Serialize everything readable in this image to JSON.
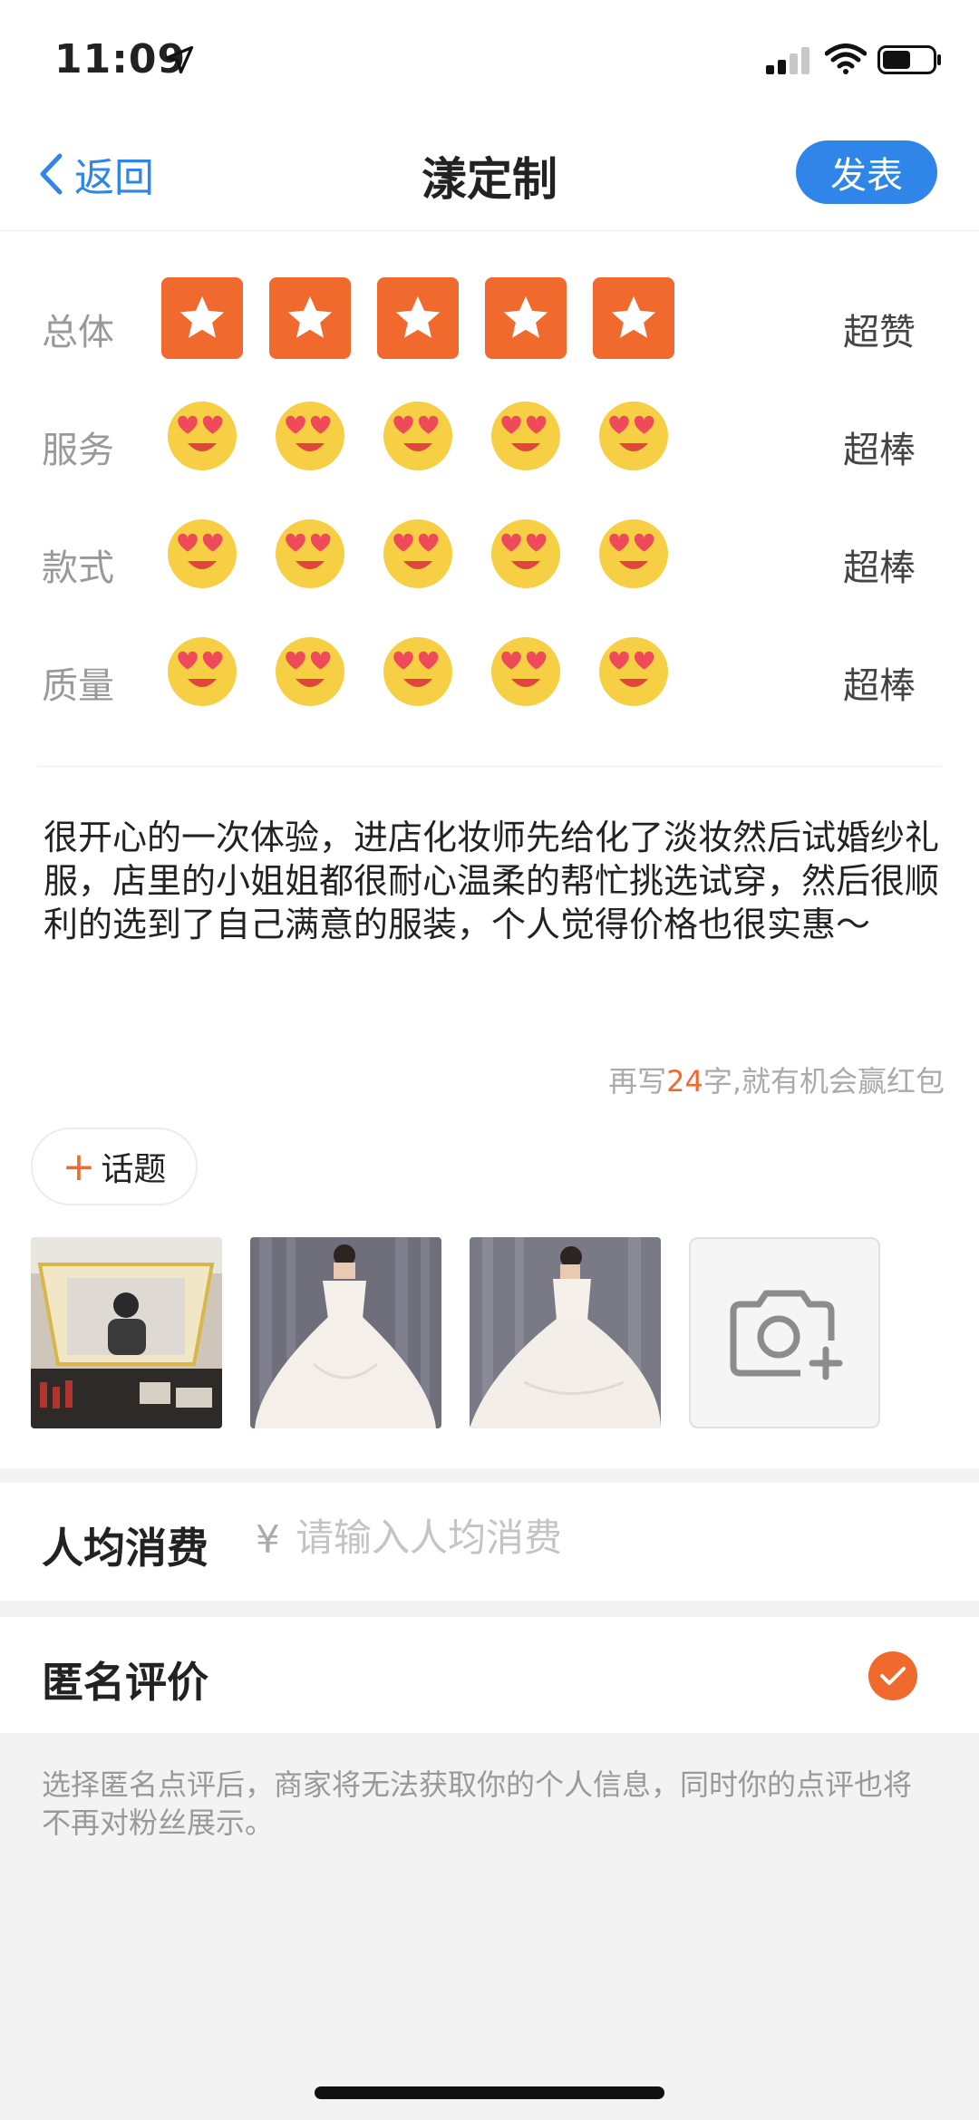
{
  "status": {
    "time": "11:09"
  },
  "nav": {
    "back_label": "返回",
    "title": "漾定制",
    "publish_label": "发表"
  },
  "ratings": [
    {
      "label": "总体",
      "icon": "star-icon",
      "score": 5,
      "max": 5,
      "value": "超赞"
    },
    {
      "label": "服务",
      "icon": "heart-eyes-emoji-icon",
      "score": 5,
      "max": 5,
      "value": "超棒"
    },
    {
      "label": "款式",
      "icon": "heart-eyes-emoji-icon",
      "score": 5,
      "max": 5,
      "value": "超棒"
    },
    {
      "label": "质量",
      "icon": "heart-eyes-emoji-icon",
      "score": 5,
      "max": 5,
      "value": "超棒"
    }
  ],
  "review": {
    "text": "很开心的一次体验，进店化妆师先给化了淡妆然后试婚纱礼服，店里的小姐姐都很耐心温柔的帮忙挑选试穿，然后很顺利的选到了自己满意的服装，个人觉得价格也很实惠～"
  },
  "hint": {
    "prefix": "再写",
    "count": "24",
    "suffix": "字,就有机会赢红包"
  },
  "topic": {
    "plus": "+",
    "label": "话题"
  },
  "photos": [
    "photo-makeup-mirror",
    "photo-wedding-dress-front",
    "photo-wedding-dress-back"
  ],
  "spend": {
    "label": "人均消费",
    "currency": "¥",
    "placeholder": "请输入人均消费",
    "value": ""
  },
  "anonymous": {
    "label": "匿名评价",
    "checked": true,
    "note": "选择匿名点评后，商家将无法获取你的个人信息，同时你的点评也将不再对粉丝展示。"
  },
  "colors": {
    "accent": "#ef6a2c",
    "brand": "#2f86e8",
    "emoji": "#f7cf45"
  }
}
